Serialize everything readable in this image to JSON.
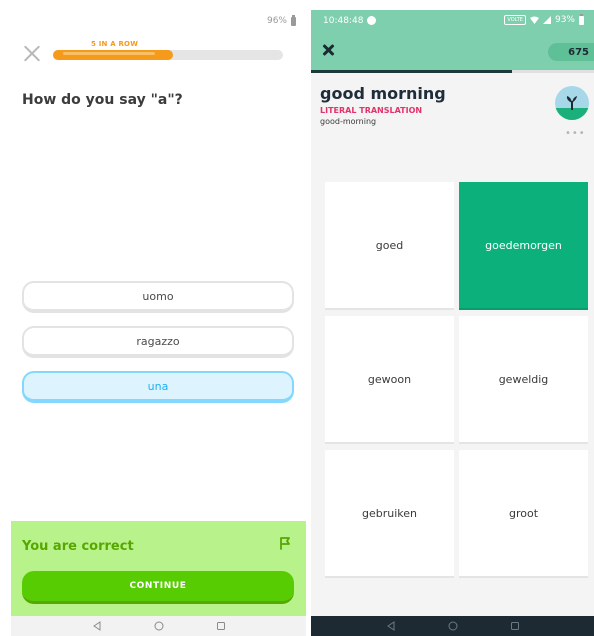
{
  "left_app": {
    "status": {
      "battery": "96%"
    },
    "streak_label": "5 IN A ROW",
    "progress": 0.52,
    "question": "How do you say \"a\"?",
    "options": [
      "uomo",
      "ragazzo",
      "una"
    ],
    "selected_option": "una",
    "feedback": {
      "title": "You are correct",
      "continue_label": "CONTINUE"
    },
    "colors": {
      "accent": "#58cc02",
      "streak": "#f59a1b",
      "selected": "#1cb0f6"
    }
  },
  "right_app": {
    "status": {
      "time": "10:48:48",
      "network": "VOLTE",
      "battery": "93%"
    },
    "points": "675",
    "progress": 0.71,
    "prompt": "good morning",
    "literal_label": "LITERAL TRANSLATION",
    "literal_value": "good-morning",
    "more_label": "•••",
    "tiles": [
      "goed",
      "goedemorgen",
      "gewoon",
      "geweldig",
      "gebruiken",
      "groot"
    ],
    "correct_tile": "goedemorgen",
    "colors": {
      "header": "#7ecfae",
      "correct": "#0bb07b",
      "literal": "#e2336b"
    }
  },
  "icons": {
    "close": "close-icon",
    "flag": "flag-icon",
    "back": "nav-back-icon",
    "home": "nav-home-icon",
    "recents": "nav-recents-icon"
  }
}
